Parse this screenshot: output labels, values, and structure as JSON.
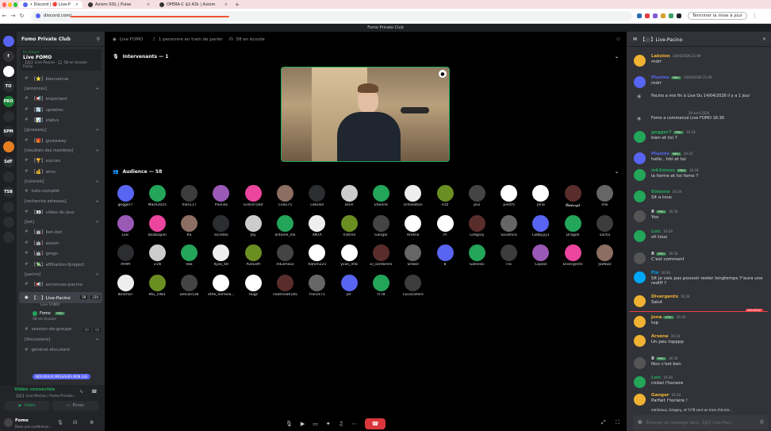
{
  "browser": {
    "tabs": [
      {
        "label": "• Discord | 🔴 Live-P",
        "active": true
      },
      {
        "label": "Axiom SOL | Pulse",
        "active": false
      },
      {
        "label": "OPERA-C $2.42k | Axiom",
        "active": false
      }
    ],
    "url": "discord.com/",
    "finish_label": "Terminer la mise à jour"
  },
  "discord_title": "Fomo Private Club",
  "server_icons": [
    "",
    "f",
    "",
    "TO",
    "PRO",
    "",
    "SPM",
    "",
    "SdF",
    "",
    "TSB",
    "",
    "",
    ""
  ],
  "channels": {
    "server_name": "Fomo Private Club",
    "live_badge": "En Direct",
    "live_title": "Live FOMO",
    "live_sub": "【🎥】Live-Pacino · 🎧 58 en écoute",
    "live_host": "Fomo",
    "items": [
      {
        "type": "ch",
        "label": "【⭐】bienvenue"
      },
      {
        "type": "cat",
        "label": "[annonces]"
      },
      {
        "type": "ch",
        "label": "【📢】important"
      },
      {
        "type": "ch",
        "label": "【🔄】updates"
      },
      {
        "type": "ch",
        "label": "【📊】status"
      },
      {
        "type": "cat",
        "label": "[giveaway]"
      },
      {
        "type": "ch",
        "label": "【🎁】giveaway"
      },
      {
        "type": "cat",
        "label": "[résultats des membres]"
      },
      {
        "type": "ch",
        "label": "【🏆】succes"
      },
      {
        "type": "ch",
        "label": "【💰】wins"
      },
      {
        "type": "cat",
        "label": "[tutoriels]"
      },
      {
        "type": "ch",
        "label": "tuto-complet"
      },
      {
        "type": "cat",
        "label": "[recherche adresses]"
      },
      {
        "type": "ch",
        "label": "【👀】video-du-jour"
      },
      {
        "type": "cat",
        "label": "[bot]"
      },
      {
        "type": "ch",
        "label": "【🤖】lien-bot"
      },
      {
        "type": "ch",
        "label": "【🤖】axiom"
      },
      {
        "type": "ch",
        "label": "【🤖】gmgn"
      },
      {
        "type": "ch",
        "label": "【💸】affiliation-fproject"
      },
      {
        "type": "cat",
        "label": "[pacino]"
      },
      {
        "type": "ch",
        "label": "【📢】annonces-pacino"
      }
    ],
    "voice_channel": {
      "label": "【🎥】Live-Pacino",
      "count_a": "59",
      "count_b": "150",
      "sub": "Live FOMO",
      "member": "Fomo",
      "member_badge": "FPRO",
      "listening": "58 en écoute"
    },
    "after_items": [
      {
        "type": "ch",
        "label": "session-de-groupe",
        "count_a": "00",
        "count_b": "08"
      },
      {
        "type": "cat",
        "label": "[discussions]"
      },
      {
        "type": "ch",
        "label": "général-discutant"
      }
    ],
    "new_messages": "NOUVEAUX MESSAGES NON LUS"
  },
  "voice_panel": {
    "status": "Vidéo connectée",
    "location": "【🎥】Live-Pacino / Fomo Private...",
    "video_label": "Vidéo",
    "screen_label": "Écran",
    "user": "Fomo",
    "user_status": "Dans une conférence..."
  },
  "main": {
    "header_title": "Live FOMO",
    "header_talking": "1 personne en train de parler",
    "header_listening": "58 en écoute",
    "speakers_label": "Intervenants — 1",
    "audience_label": "Audience — 58",
    "audience": [
      [
        "gegger7",
        "Mash2025",
        "halo117",
        "Pluniox",
        "Grand Dad",
        "Ceau75",
        "Lakslon",
        "zenn",
        "Etienne",
        "schokobon",
        "Fizz",
        "ps2",
        "pestr0",
        "Jona",
        "𝓛𝓾𝓭𝔀𝓲𝓰𝓫",
        "Irsk"
      ],
      [
        "Loic",
        "Barboquin",
        "KS",
        "ecceteo",
        "Jey",
        "antoine_mk",
        "ANTA",
        "Tristren",
        "Gangar",
        "Arsène",
        "PI",
        "Gregory",
        "Soulshiro",
        "Lobbyyy1",
        "Dragoh",
        "sacha"
      ],
      [
        "AYAM",
        "21N",
        "Vok",
        "Ilyas_69",
        "AveLeM",
        "mk3mous",
        "Rahim225",
        "yvan_lmb",
        "El_sombrero",
        "SmBel",
        "8",
        "Gotenks",
        "Flo",
        "Coplan",
        "Divergents",
        "JoeNizz"
      ],
      [
        "Ibramsir",
        "MG_1981",
        "Delcan536",
        "ethe_homela...",
        "Hugz",
        "noahnoah185",
        "franck71",
        "Jer",
        "Yr78",
        "Cocacollero"
      ]
    ]
  },
  "chat": {
    "channel": "【🎥】Live-Pacino",
    "date_sep": "19 avril 2026",
    "new_label": "NOUVEAU",
    "messages": [
      {
        "user": "Lakslon",
        "time": "14/04/2026 21:09",
        "text": "mdrr",
        "color": "#f0b232",
        "badge": ""
      },
      {
        "user": "Pluniox",
        "time": "14/04/2026 21:09",
        "text": "mdrr",
        "color": "#5865f2",
        "badge": "MIKU"
      },
      {
        "sys": "Pacino a mis fin à Live Du 14/04/2026 il y a 1 jour"
      },
      {
        "sys": "Fomo a commencé Live FOMO 16:36"
      },
      {
        "user": "gegger7",
        "time": "16:33",
        "text": "bien et toi ?",
        "color": "#23a55a",
        "badge": "FPRO"
      },
      {
        "user": "Pluniox",
        "time": "16:33",
        "text": "hello , trkl et toi",
        "color": "#5865f2",
        "badge": "MIKU"
      },
      {
        "user": "mk3mous",
        "time": "16:34",
        "text": "la forme et toi fomo ?",
        "color": "#23a55a",
        "badge": "FPRO"
      },
      {
        "user": "Etienne",
        "time": "16:34",
        "text": "Slt a tous",
        "color": "#23a55a",
        "badge": ""
      },
      {
        "user": "8",
        "time": "16:34",
        "text": "Yoo",
        "color": "#dbdee1",
        "badge": "FPRO"
      },
      {
        "user": "Loic",
        "time": "16:34",
        "text": "slt tous",
        "color": "#23a55a",
        "badge": ""
      },
      {
        "user": "8",
        "time": "16:34",
        "text": "C'est comment",
        "color": "#dbdee1",
        "badge": "FPRO"
      },
      {
        "user": "Flo",
        "time": "16:34",
        "text": "Slt je vais pas pouvoir rester longtemps Y'aura une rediff ?",
        "color": "#00a8fc",
        "badge": ""
      },
      {
        "user": "Divergents",
        "time": "16:34",
        "text": "Salut",
        "color": "#f0b232",
        "badge": ""
      },
      {
        "user": "Jona",
        "time": "16:34",
        "text": "top",
        "color": "#f0b232",
        "badge": "FPRO"
      },
      {
        "user": "Arsène",
        "time": "16:34",
        "text": "Un peu topppp",
        "color": "#f0b232",
        "badge": ""
      },
      {
        "user": "8",
        "time": "16:34",
        "text": "Non c'est bon",
        "color": "#dbdee1",
        "badge": "FPRO"
      },
      {
        "user": "Loic",
        "time": "16:34",
        "text": "nickel l'horaire",
        "color": "#23a55a",
        "badge": ""
      },
      {
        "user": "Gangar",
        "time": "16:34",
        "text": "Parfait l'horaire !",
        "color": "#f0b232",
        "badge": ""
      }
    ],
    "typing": "mk3mous, Gregory, et Yr78 sont en train d'écrire...",
    "composer_placeholder": "Envoyer un message dans 【🎥】Live-Paci..."
  }
}
